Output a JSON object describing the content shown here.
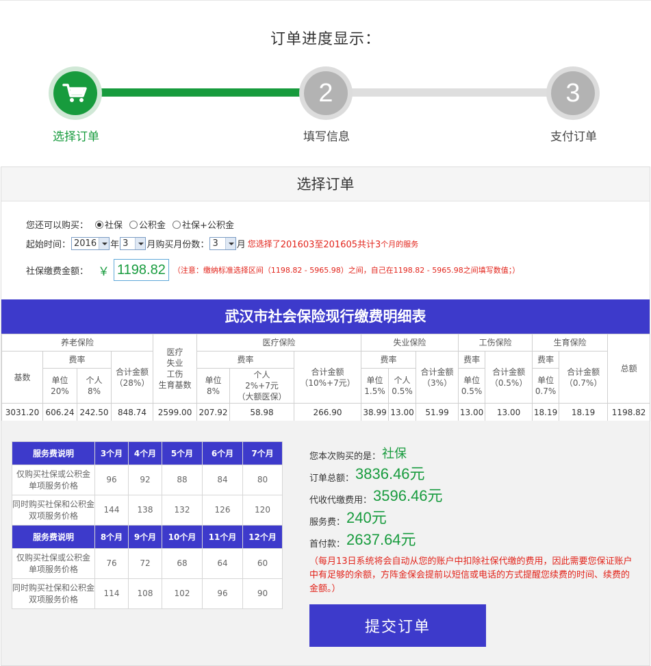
{
  "progress": {
    "title": "订单进度显示：",
    "steps": [
      {
        "num": "",
        "label": "选择订单",
        "icon": "cart-icon"
      },
      {
        "num": "2",
        "label": "填写信息"
      },
      {
        "num": "3",
        "label": "支付订单"
      }
    ]
  },
  "section": {
    "title": "选择订单"
  },
  "form": {
    "buy_label": "您还可以购买：",
    "options": [
      "社保",
      "公积金",
      "社保+公积金"
    ],
    "start_label": "起始时间：",
    "year": "2016",
    "year_unit": "年",
    "month": "3",
    "month_unit": "月",
    "count_label": "购买月份数：",
    "count": "3",
    "count_unit": "月",
    "selected_prefix": "您选择了",
    "selected_range": "201603至201605共计3",
    "selected_suffix": "个月的服务",
    "amount_label": "社保缴费金额：",
    "currency": "￥",
    "amount": "1198.82",
    "note": "（注意：缴纳标准选择区间（1198.82 - 5965.98）之间，自己在1198.82 - 5965.98之间填写数值；）"
  },
  "detail": {
    "title": "武汉市社会保险现行缴费明细表",
    "h": {
      "pension": "养老保险",
      "medical_base_1": "医疗",
      "medical_base_2": "失业",
      "medical_base_3": "工伤",
      "medical_base_4": "生育基数",
      "medical": "医疗保险",
      "unemployment": "失业保险",
      "injury": "工伤保险",
      "maternity": "生育保险",
      "base": "基数",
      "rate": "费率",
      "total_label": "合计金额",
      "grand_total": "总额",
      "unit": "单位",
      "personal": "个人",
      "p_unit_rate": "20%",
      "p_pers_rate": "8%",
      "p_total_rate": "（28%）",
      "m_unit_rate": "8%",
      "m_pers_rate": "2%+7元",
      "m_pers_note": "（大额医保）",
      "m_total_rate": "（10%+7元）",
      "u_unit_rate": "1.5%",
      "u_pers_rate": "0.5%",
      "u_total_rate": "（3%）",
      "i_unit_rate": "0.5%",
      "i_total_rate": "（0.5%）",
      "b_unit_rate": "0.7%",
      "b_total_rate": "（0.7%）"
    },
    "values": [
      "3031.20",
      "606.24",
      "242.50",
      "848.74",
      "2599.00",
      "207.92",
      "58.98",
      "266.90",
      "38.99",
      "13.00",
      "51.99",
      "13.00",
      "13.00",
      "18.19",
      "18.19",
      "1198.82"
    ]
  },
  "fee": {
    "header_label": "服务费说明",
    "months_a": [
      "3个月",
      "4个月",
      "5个月",
      "6个月",
      "7个月"
    ],
    "months_b": [
      "8个月",
      "9个月",
      "10个月",
      "11个月",
      "12个月"
    ],
    "single_1": "仅购买社保或公积金",
    "single_2": "单项服务价格",
    "double_1": "同时购买社保和公积金",
    "double_2": "双项服务价格",
    "single_a": [
      "96",
      "92",
      "88",
      "84",
      "80"
    ],
    "double_a": [
      "144",
      "138",
      "132",
      "126",
      "120"
    ],
    "single_b": [
      "76",
      "72",
      "68",
      "64",
      "60"
    ],
    "double_b": [
      "114",
      "108",
      "102",
      "96",
      "90"
    ]
  },
  "summary": {
    "bought_label": "您本次购买的是：",
    "bought_value": "社保",
    "total_label": "订单总额：",
    "total_value": "3836.46元",
    "agency_label": "代收代缴费用：",
    "agency_value": "3596.46元",
    "service_label": "服务费：",
    "service_value": "240元",
    "first_label": "首付款：",
    "first_value": "2637.64元",
    "tip": "（每月13日系统将会自动从您的账户中扣除社保代缴的费用，因此需要您保证账户中有足够的余额，方阵金保会提前以短信或电话的方式提醒您续费的时间、续费的金额。）",
    "submit": "提交订单"
  }
}
